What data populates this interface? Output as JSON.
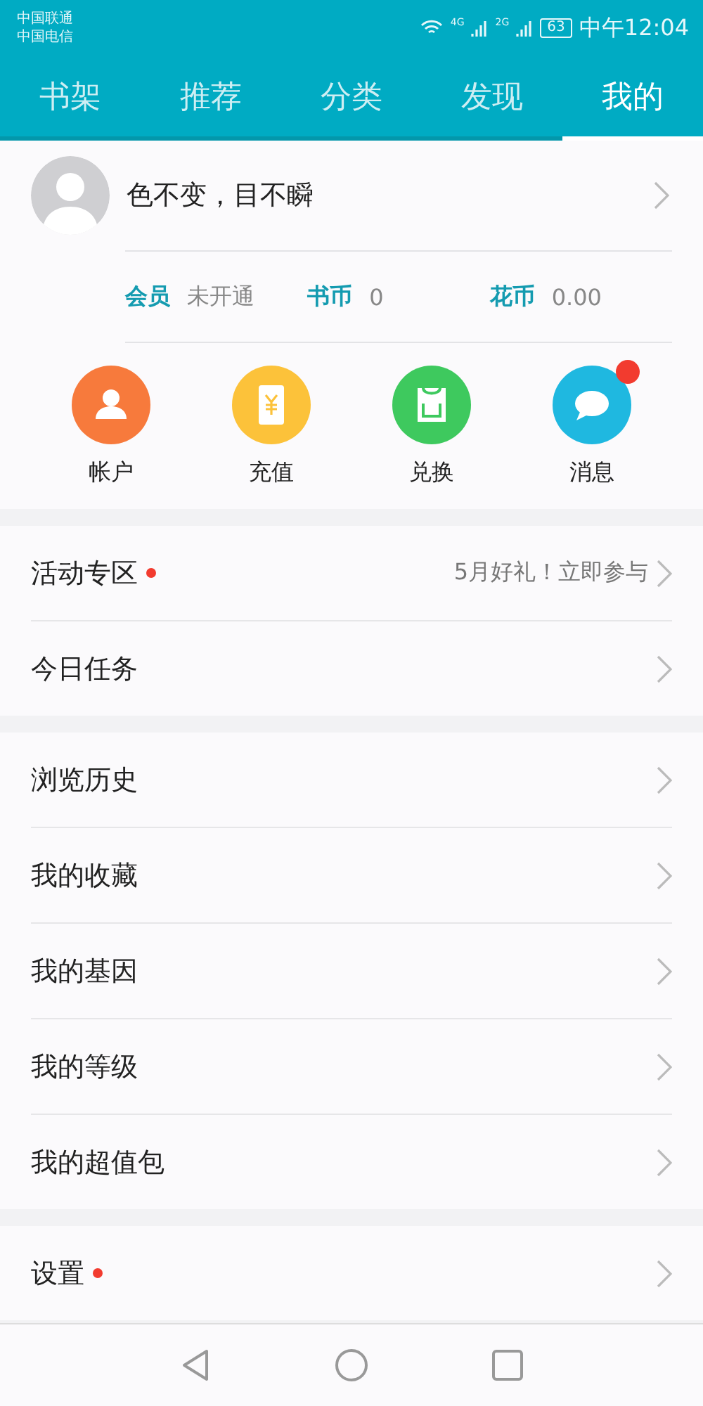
{
  "status_bar": {
    "carriers": [
      "中国联通",
      "中国电信"
    ],
    "network_1": "4G",
    "network_2": "2G",
    "battery": "63",
    "time": "中午12:04"
  },
  "tabs": [
    {
      "label": "书架",
      "selected": false
    },
    {
      "label": "推荐",
      "selected": false
    },
    {
      "label": "分类",
      "selected": false
    },
    {
      "label": "发现",
      "selected": false
    },
    {
      "label": "我的",
      "selected": true
    }
  ],
  "profile": {
    "name": "色不变，目不瞬",
    "stats": [
      {
        "label": "会员",
        "value": "未开通"
      },
      {
        "label": "书币",
        "value": "0"
      },
      {
        "label": "花币",
        "value": "0.00"
      }
    ],
    "shortcuts": [
      {
        "label": "帐户",
        "kind": "person",
        "color": "#f77a3c",
        "badge": false
      },
      {
        "label": "充值",
        "kind": "yuan",
        "color": "#fcc23a",
        "badge": false
      },
      {
        "label": "兑换",
        "kind": "bag",
        "color": "#3ec95e",
        "badge": false
      },
      {
        "label": "消息",
        "kind": "chat",
        "color": "#1fb8e0",
        "badge": true
      }
    ]
  },
  "sections": [
    [
      {
        "label": "活动专区",
        "dot": true,
        "note": "5月好礼！立即参与"
      },
      {
        "label": "今日任务",
        "dot": false
      }
    ],
    [
      {
        "label": "浏览历史",
        "dot": false
      },
      {
        "label": "我的收藏",
        "dot": false
      },
      {
        "label": "我的基因",
        "dot": false
      },
      {
        "label": "我的等级",
        "dot": false
      },
      {
        "label": "我的超值包",
        "dot": false
      }
    ],
    [
      {
        "label": "设置",
        "dot": true
      }
    ]
  ]
}
